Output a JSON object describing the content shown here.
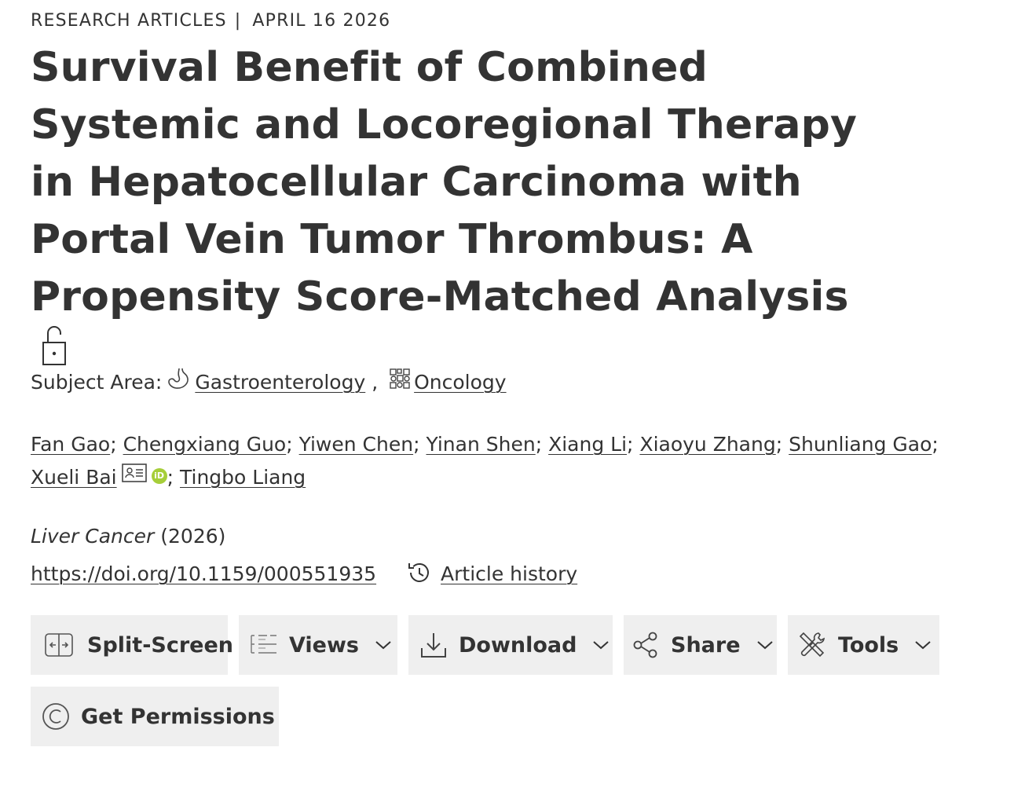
{
  "header": {
    "category": "RESEARCH ARTICLES",
    "separator": "|",
    "date": "APRIL 16 2026"
  },
  "article": {
    "title": "Survival Benefit of Combined Systemic and Locoregional Therapy in Hepatocellular Carcinoma with Portal Vein Tumor Thrombus: A Propensity Score-Matched Analysis",
    "subject_label": "Subject Area:",
    "subjects": [
      "Gastroenterology",
      "Oncology"
    ],
    "subject_separator": ",",
    "authors": [
      "Fan Gao",
      "Chengxiang Guo",
      "Yiwen Chen",
      "Yinan Shen",
      "Xiang Li",
      "Xiaoyu Zhang",
      "Shunliang Gao",
      "Xueli Bai",
      "Tingbo Liang"
    ],
    "author_separator": ";",
    "orcid_label": "iD",
    "journal": "Liver Cancer",
    "year": "(2026)",
    "doi": "https://doi.org/10.1159/000551935",
    "history_label": "Article history"
  },
  "toolbar": {
    "split_screen": "Split-Screen",
    "views": "Views",
    "download": "Download",
    "share": "Share",
    "tools": "Tools",
    "permissions": "Get Permissions"
  },
  "colors": {
    "text": "#333333",
    "button_bg": "#efefef",
    "orcid": "#a6ce39"
  },
  "icons": [
    "open-access-lock-icon",
    "stomach-icon",
    "cells-icon",
    "contact-card-icon",
    "orcid-icon",
    "history-icon",
    "split-screen-icon",
    "views-list-icon",
    "download-icon",
    "share-icon",
    "tools-icon",
    "copyright-icon",
    "chevron-down-icon"
  ]
}
